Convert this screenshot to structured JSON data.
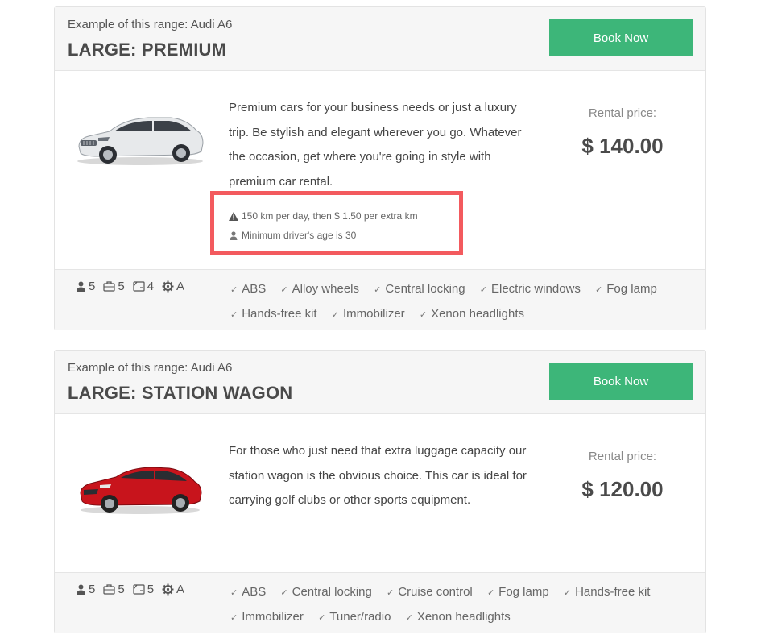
{
  "listings": [
    {
      "example": "Example of this range: Audi A6",
      "title": "LARGE: PREMIUM",
      "book_label": "Book Now",
      "description": "Premium cars for your business needs or just a luxury trip. Be stylish and elegant wherever you go. Whatever the occasion, get where you're going in style with premium car rental.",
      "price_label": "Rental price:",
      "price": "$ 140.00",
      "notes": [
        "150 km per day, then $ 1.50 per extra km",
        "Minimum driver's age is 30"
      ],
      "specs": {
        "passengers": "5",
        "luggage": "5",
        "doors": "4",
        "transmission": "A"
      },
      "features": [
        "ABS",
        "Alloy wheels",
        "Central locking",
        "Electric windows",
        "Fog lamp",
        "Hands-free kit",
        "Immobilizer",
        "Xenon headlights"
      ],
      "car_color": "#e6e8ea"
    },
    {
      "example": "Example of this range: Audi A6",
      "title": "LARGE: STATION WAGON",
      "book_label": "Book Now",
      "description": "For those who just need that extra luggage capacity our station wagon is the obvious choice. This car is ideal for carrying golf clubs or other sports equipment.",
      "price_label": "Rental price:",
      "price": "$ 120.00",
      "specs": {
        "passengers": "5",
        "luggage": "5",
        "doors": "5",
        "transmission": "A"
      },
      "features": [
        "ABS",
        "Central locking",
        "Cruise control",
        "Fog lamp",
        "Hands-free kit",
        "Immobilizer",
        "Tuner/radio",
        "Xenon headlights"
      ],
      "car_color": "#c8141c"
    }
  ],
  "colors": {
    "book_button": "#3db679",
    "highlight": "#f35a5e",
    "header_bg": "#f6f6f6"
  }
}
